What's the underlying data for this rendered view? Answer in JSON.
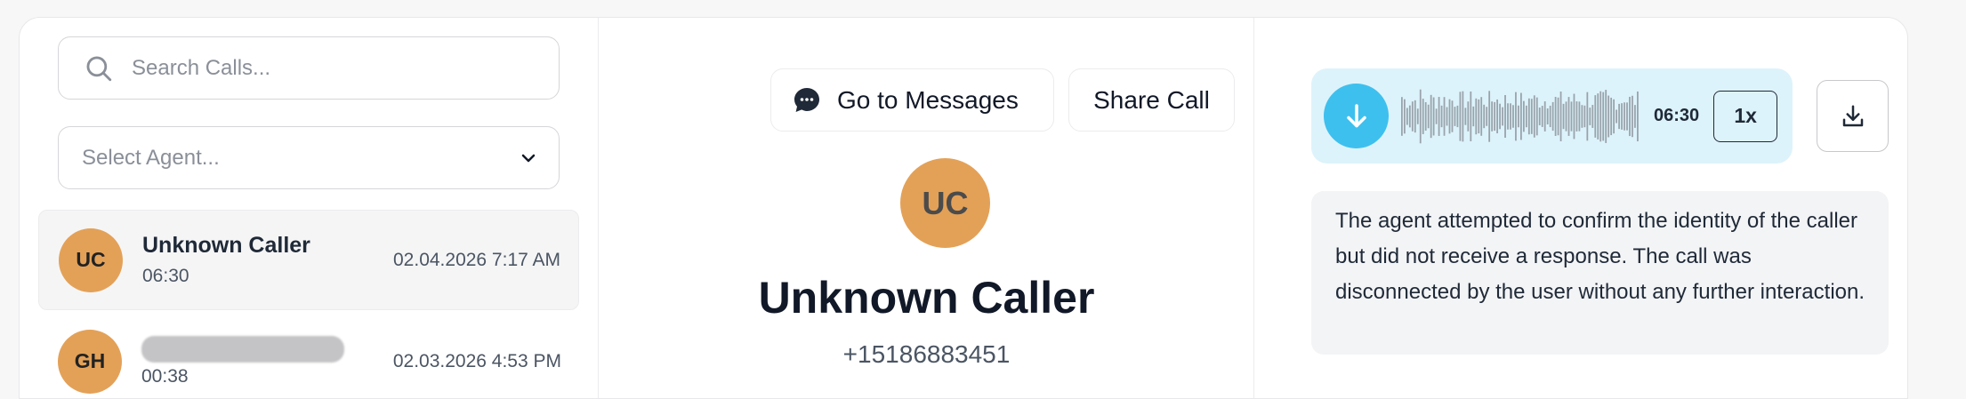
{
  "search": {
    "placeholder": "Search Calls..."
  },
  "agent_select": {
    "placeholder": "Select Agent..."
  },
  "calls": [
    {
      "initials": "UC",
      "name": "Unknown Caller",
      "duration": "06:30",
      "date": "02.04.2026 7:17 AM",
      "active": true
    },
    {
      "initials": "GH",
      "name": "",
      "duration": "00:38",
      "date": "02.03.2026 4:53 PM",
      "active": false
    }
  ],
  "detail": {
    "go_to_messages_label": "Go to Messages",
    "share_call_label": "Share Call",
    "initials": "UC",
    "name": "Unknown Caller",
    "phone": "+15186883451"
  },
  "player": {
    "duration": "06:30",
    "speed": "1x",
    "play_icon": "arrow-down-icon",
    "download_icon": "download-icon"
  },
  "summary": "The agent attempted to confirm the identity of the caller but did not receive a response. The call was disconnected by the user without any further interaction.",
  "colors": {
    "avatar": "#e3a158",
    "player_bg": "#ddf3fb",
    "play_button": "#3ec0ee",
    "waveform": "#9aa3ab"
  }
}
